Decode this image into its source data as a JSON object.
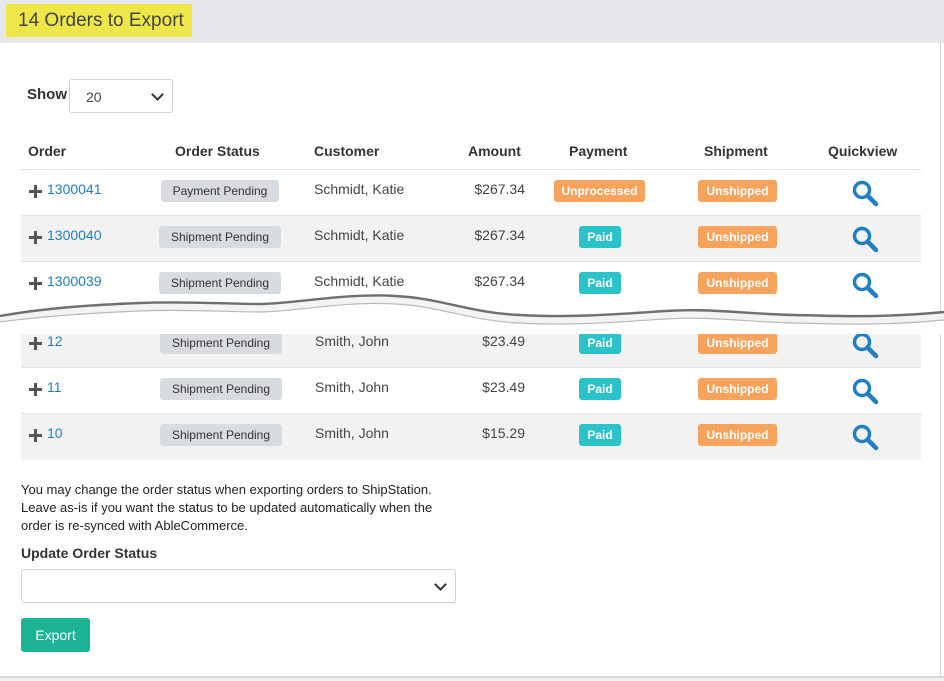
{
  "header": {
    "title": "14 Orders to Export"
  },
  "controls": {
    "show_label": "Show",
    "show_value": "20"
  },
  "table": {
    "headers": [
      "Order",
      "Order Status",
      "Customer",
      "Amount",
      "Payment",
      "Shipment",
      "Quickview"
    ],
    "rows": [
      {
        "order": "1300041",
        "status": "Payment Pending",
        "customer": "Schmidt, Katie",
        "amount": "$267.34",
        "payment": "Unprocessed",
        "shipment": "Unshipped"
      },
      {
        "order": "1300040",
        "status": "Shipment Pending",
        "customer": "Schmidt, Katie",
        "amount": "$267.34",
        "payment": "Paid",
        "shipment": "Unshipped"
      },
      {
        "order": "1300039",
        "status": "Shipment Pending",
        "customer": "Schmidt, Katie",
        "amount": "$267.34",
        "payment": "Paid",
        "shipment": "Unshipped"
      },
      {
        "order": "12",
        "status": "Shipment Pending",
        "customer": "Smith, John",
        "amount": "$23.49",
        "payment": "Paid",
        "shipment": "Unshipped"
      },
      {
        "order": "11",
        "status": "Shipment Pending",
        "customer": "Smith, John",
        "amount": "$23.49",
        "payment": "Paid",
        "shipment": "Unshipped"
      },
      {
        "order": "10",
        "status": "Shipment Pending",
        "customer": "Smith, John",
        "amount": "$15.29",
        "payment": "Paid",
        "shipment": "Unshipped"
      }
    ]
  },
  "footer": {
    "note": "You may change the order status when exporting orders to ShipStation. Leave as-is if you want the status to be updated automatically when the order is re-synced with AbleCommerce.",
    "update_label": "Update Order Status",
    "update_value": "",
    "export_label": "Export"
  },
  "icons": {
    "expand": "plus-icon",
    "quickview": "magnifier-icon",
    "select": "chevron-down-icon"
  },
  "colors": {
    "title_highlight": "#ede74a",
    "link": "#1f7fc3",
    "paid": "#2cc2c9",
    "unprocessed": "#f7a35c",
    "unshipped": "#f7a35c",
    "export_button": "#1bb394"
  }
}
